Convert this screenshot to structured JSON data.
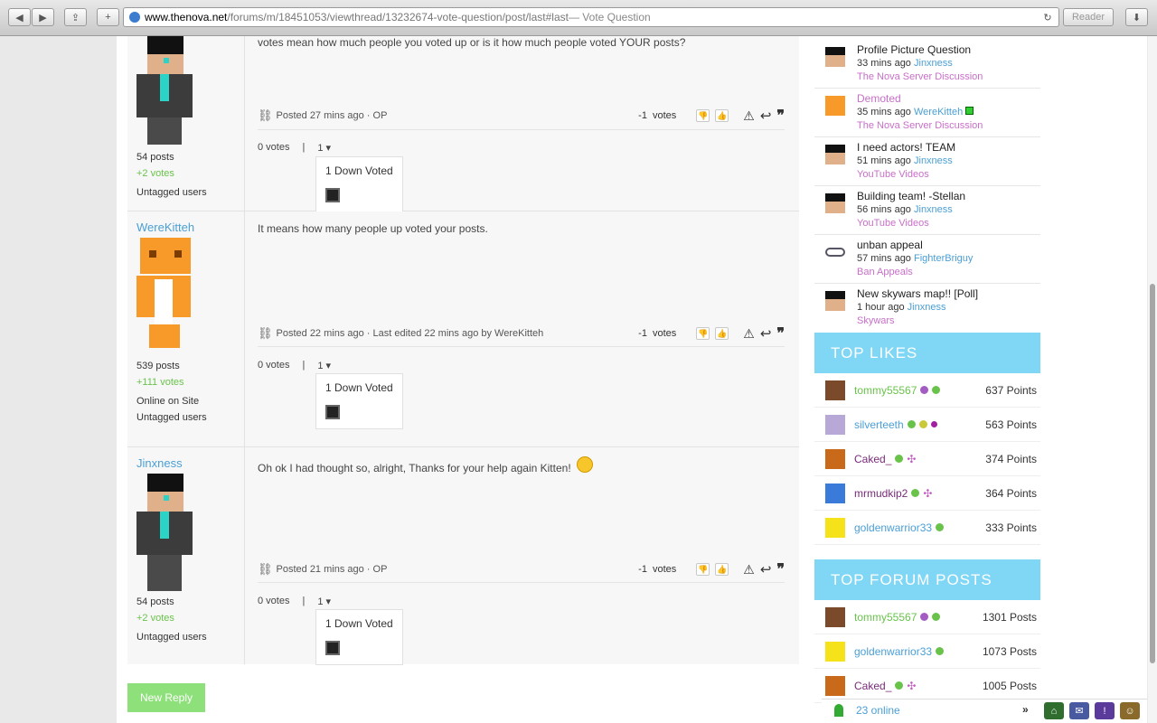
{
  "browser": {
    "url_domain": "www.thenova.net",
    "url_path": "/forums/m/18451053/viewthread/13232674-vote-question/post/last#last",
    "title_suffix": " — Vote Question",
    "reader_label": "Reader"
  },
  "posts": [
    {
      "username": "",
      "posts_count": "54 posts",
      "votes_count": "+2 votes",
      "online": "",
      "tag": "Untagged users",
      "message": "votes mean how much people you voted up or is it how much people voted YOUR posts?",
      "posted": "Posted 27 mins ago · OP",
      "vote_score": "-1",
      "vote_word": "votes",
      "zero_votes": "0 votes",
      "pipe": "|",
      "select_val": "1",
      "down_voted": "1 Down Voted"
    },
    {
      "username": "WereKitteh",
      "posts_count": "539 posts",
      "votes_count": "+111 votes",
      "online": "Online on Site",
      "tag": "Untagged users",
      "message": "It means how many people up voted your posts.",
      "posted": "Posted 22 mins ago · Last edited 22 mins ago by WereKitteh",
      "vote_score": "-1",
      "vote_word": "votes",
      "zero_votes": "0 votes",
      "pipe": "|",
      "select_val": "1",
      "down_voted": "1 Down Voted"
    },
    {
      "username": "Jinxness",
      "posts_count": "54 posts",
      "votes_count": "+2 votes",
      "online": "",
      "tag": "Untagged users",
      "message": "Oh ok I had thought so, alright, Thanks for your help again Kitten!",
      "posted": "Posted 21 mins ago · OP",
      "vote_score": "-1",
      "vote_word": "votes",
      "zero_votes": "0 votes",
      "pipe": "|",
      "select_val": "1",
      "down_voted": "1 Down Voted"
    }
  ],
  "new_reply_label": "New Reply",
  "recent_threads": [
    {
      "title": "Profile Picture Question",
      "time": "33 mins ago",
      "author": "Jinxness",
      "category": "The Nova Server Discussion"
    },
    {
      "title": "Demoted",
      "time": "35 mins ago",
      "author": "WereKitteh",
      "category": "The Nova Server Discussion"
    },
    {
      "title": "I need actors! TEAM",
      "time": "51 mins ago",
      "author": "Jinxness",
      "category": "YouTube Videos"
    },
    {
      "title": "Building team! -Stellan",
      "time": "56 mins ago",
      "author": "Jinxness",
      "category": "YouTube Videos"
    },
    {
      "title": "unban appeal",
      "time": "57 mins ago",
      "author": "FighterBriguy",
      "category": "Ban Appeals"
    },
    {
      "title": "New skywars map!! [Poll]",
      "time": "1 hour ago",
      "author": "Jinxness",
      "category": "Skywars"
    }
  ],
  "top_likes_header": "TOP LIKES",
  "top_likes": [
    {
      "name": "tommy55567",
      "points": "637 Points",
      "color": "#69c34b"
    },
    {
      "name": "silverteeth",
      "points": "563 Points",
      "color": "#4a9fd6"
    },
    {
      "name": "Caked_",
      "points": "374 Points",
      "color": "#7a2a7a"
    },
    {
      "name": "mrmudkip2",
      "points": "364 Points",
      "color": "#7a2a7a"
    },
    {
      "name": "goldenwarrior33",
      "points": "333 Points",
      "color": "#4a9fd6"
    }
  ],
  "top_posts_header": "TOP FORUM POSTS",
  "top_posts": [
    {
      "name": "tommy55567",
      "points": "1301 Posts",
      "color": "#69c34b"
    },
    {
      "name": "goldenwarrior33",
      "points": "1073 Posts",
      "color": "#4a9fd6"
    },
    {
      "name": "Caked_",
      "points": "1005 Posts",
      "color": "#7a2a7a"
    }
  ],
  "online_count": "23 online"
}
